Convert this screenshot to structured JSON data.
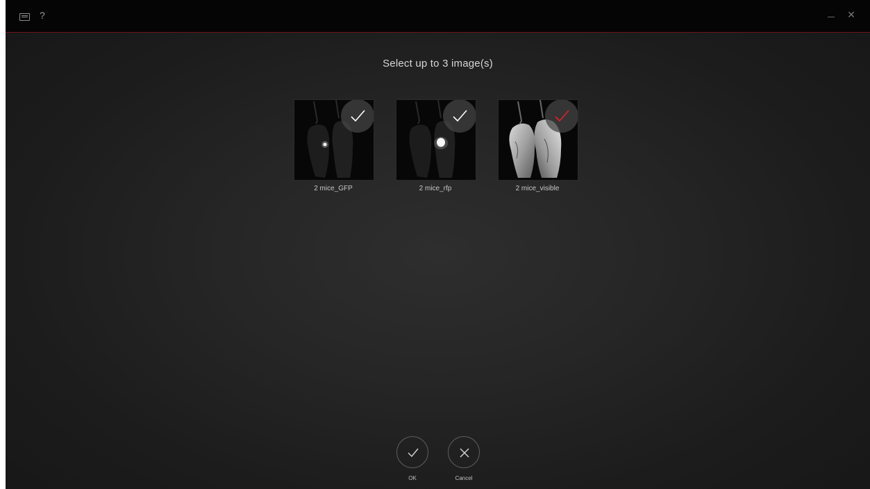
{
  "titlebar": {
    "keyboard_icon": "keyboard-icon",
    "help_label": "?",
    "minimize_label": "—",
    "close_label": "✕",
    "accent_color": "#6e1218"
  },
  "dialog": {
    "heading": "Select up to 3 image(s)"
  },
  "images": [
    {
      "name": "2 mice_GFP",
      "selected": true,
      "check_color": "#ffffff"
    },
    {
      "name": "2 mice_rfp",
      "selected": true,
      "check_color": "#ffffff"
    },
    {
      "name": "2 mice_visible",
      "selected": true,
      "check_color": "#e0202a"
    }
  ],
  "actions": {
    "ok_label": "OK",
    "cancel_label": "Cancel"
  }
}
